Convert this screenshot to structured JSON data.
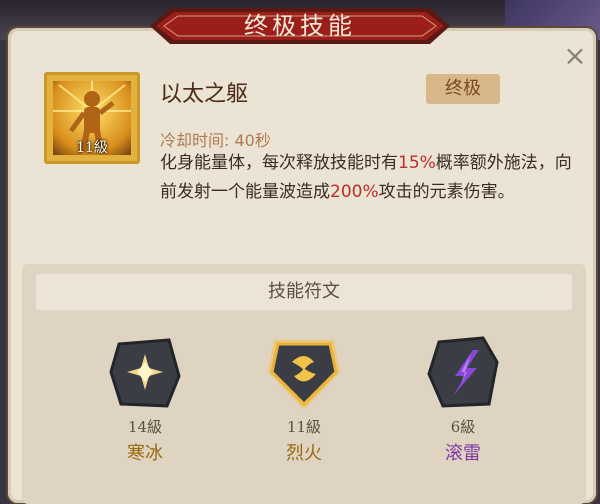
{
  "header": {
    "title": "终极技能"
  },
  "skill": {
    "name": "以太之躯",
    "level": "11級",
    "badge": "终极",
    "cooldown": "冷却时间: 40秒",
    "desc_1": "化身能量体，每次释放技能时有",
    "desc_2": "15%",
    "desc_3": "概率额外施法，向前发射一个能量波造成",
    "desc_4": "200%",
    "desc_5": "攻击的元素伤害。"
  },
  "runes": {
    "title": "技能符文",
    "items": [
      {
        "level": "14級",
        "name": "寒冰",
        "icon": "ice-star-icon"
      },
      {
        "level": "11級",
        "name": "烈火",
        "icon": "fire-swirl-icon"
      },
      {
        "level": "6級",
        "name": "滚雷",
        "icon": "thunder-icon"
      }
    ]
  },
  "colors": {
    "highlight": "#b8302c",
    "gold": "#e3b23e",
    "banner": "#9a1f1a",
    "thunder": "#8a46d8"
  }
}
